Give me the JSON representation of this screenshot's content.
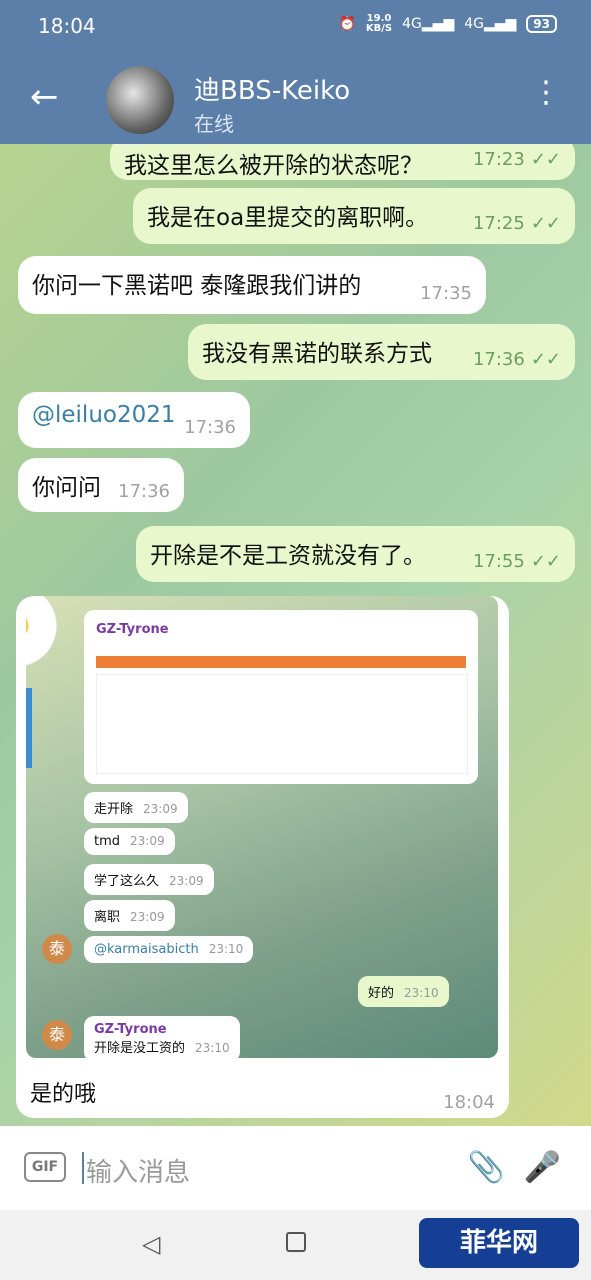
{
  "status_bar": {
    "time": "18:04",
    "speed_value": "19.0",
    "speed_unit": "KB/S",
    "net_1": "4G",
    "net_2": "4G",
    "battery": "93"
  },
  "header": {
    "back_icon": "arrow-left-icon",
    "title": "迪BBS-Keiko",
    "subtitle": "在线",
    "menu_icon": "more-vertical-icon"
  },
  "messages": [
    {
      "direction": "out",
      "text": "我这里怎么被开除的状态呢？",
      "time": "17:23",
      "read": true
    },
    {
      "direction": "out",
      "text": "我是在oa里提交的离职啊。",
      "time": "17:25",
      "read": true
    },
    {
      "direction": "in",
      "text": "你问一下黑诺吧 泰隆跟我们讲的",
      "time": "17:35"
    },
    {
      "direction": "out",
      "text": "我没有黑诺的联系方式",
      "time": "17:36",
      "read": true
    },
    {
      "direction": "in",
      "text": "@leiluo2021",
      "time": "17:36",
      "mention": true
    },
    {
      "direction": "in",
      "text": "你问问",
      "time": "17:36"
    },
    {
      "direction": "out",
      "text": "开除是不是工资就没有了。",
      "time": "17:55",
      "read": true
    }
  ],
  "media_message": {
    "caption": "是的哦",
    "time": "18:04",
    "embedded": {
      "card_title": "GZ-Tyrone",
      "bubbles": [
        {
          "direction": "in",
          "text": "走开除",
          "time": "23:09"
        },
        {
          "direction": "in",
          "text": "tmd",
          "time": "23:09"
        },
        {
          "direction": "in",
          "text": "学了这么久",
          "time": "23:09"
        },
        {
          "direction": "in",
          "text": "离职",
          "time": "23:09"
        },
        {
          "direction": "in",
          "text": "@karmaisabicth",
          "time": "23:10",
          "avatar": "泰"
        },
        {
          "direction": "out",
          "text": "好的",
          "time": "23:10"
        },
        {
          "direction": "in",
          "name": "GZ-Tyrone",
          "text": "开除是没工资的",
          "time": "23:10",
          "avatar": "泰"
        }
      ]
    }
  },
  "input_bar": {
    "gif_label": "GIF",
    "placeholder": "输入消息",
    "attach_icon": "paperclip-icon",
    "mic_icon": "microphone-icon"
  },
  "nav_bar": {
    "back_icon": "triangle-back-icon",
    "home_icon": "square-home-icon"
  },
  "watermark": {
    "text": "菲华网"
  }
}
